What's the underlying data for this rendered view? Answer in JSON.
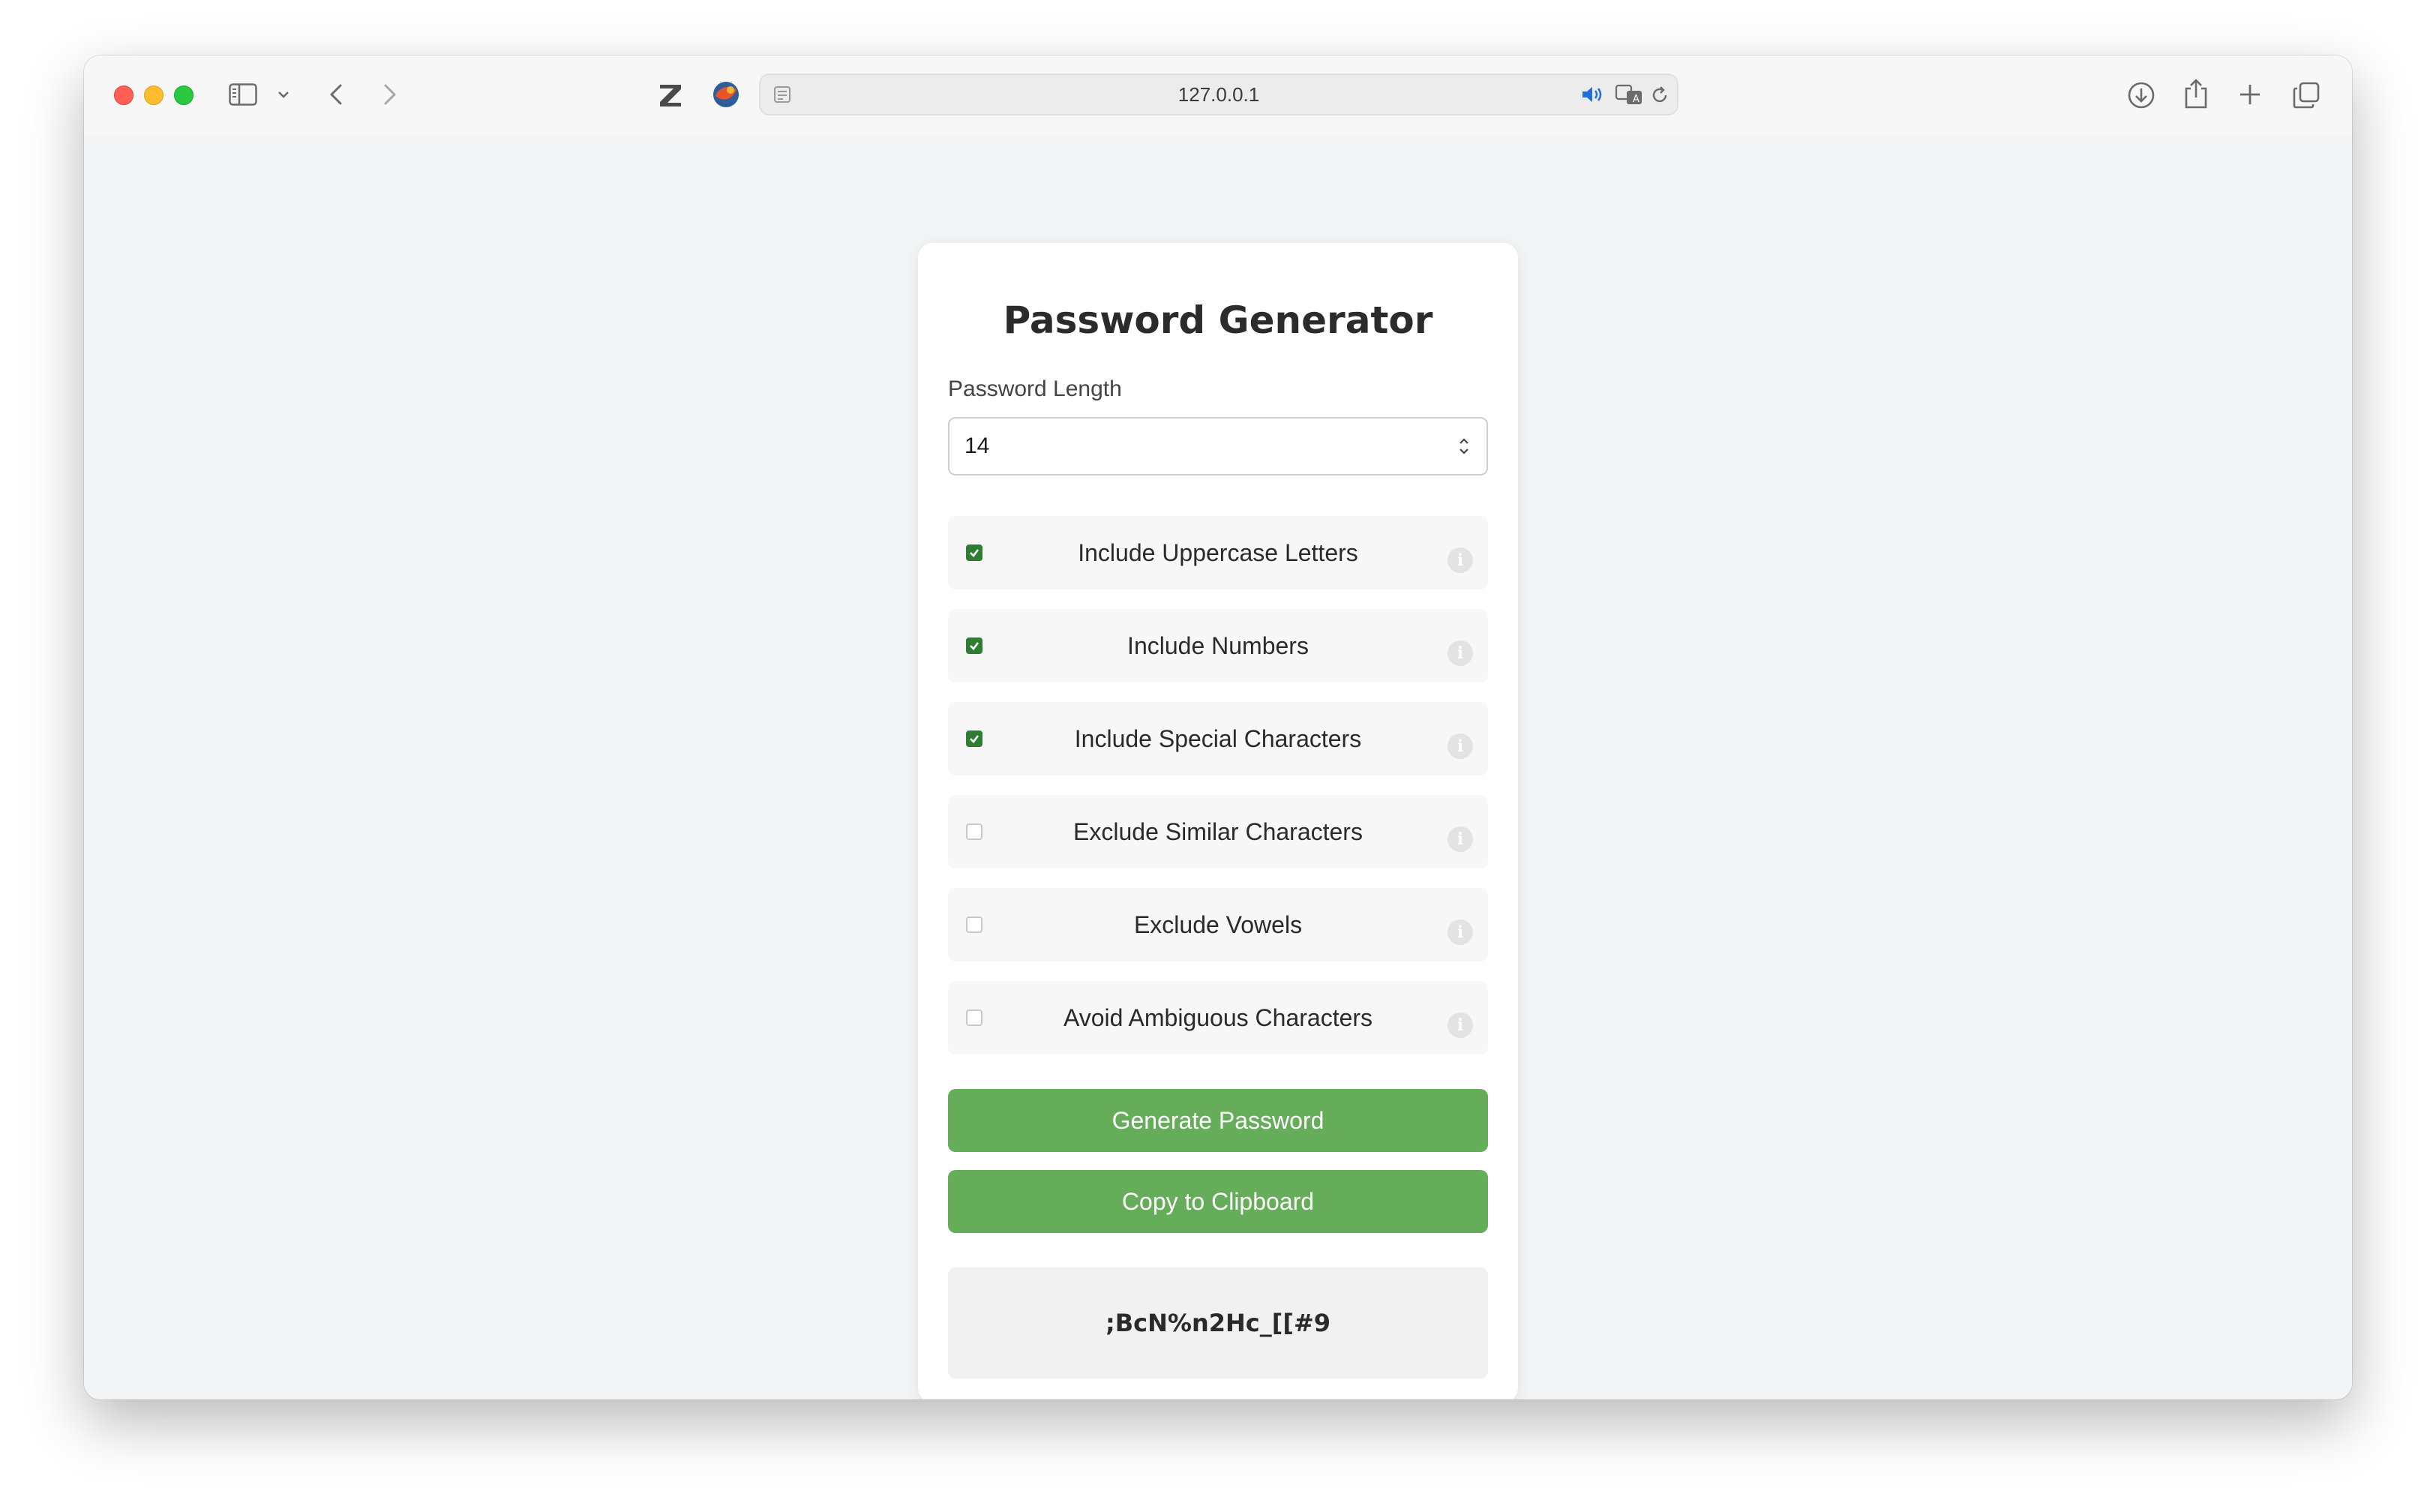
{
  "browser": {
    "url": "127.0.0.1"
  },
  "page": {
    "title": "Password Generator",
    "length_label": "Password Length",
    "length_value": "14",
    "options": [
      {
        "label": "Include Uppercase Letters",
        "checked": true
      },
      {
        "label": "Include Numbers",
        "checked": true
      },
      {
        "label": "Include Special Characters",
        "checked": true
      },
      {
        "label": "Exclude Similar Characters",
        "checked": false
      },
      {
        "label": "Exclude Vowels",
        "checked": false
      },
      {
        "label": "Avoid Ambiguous Characters",
        "checked": false
      }
    ],
    "info_glyph": "i",
    "generate_button": "Generate Password",
    "copy_button": "Copy to Clipboard",
    "generated_password": ";BcN%n2Hc_[[#9"
  },
  "colors": {
    "accent_green": "#66ad5a",
    "checkbox_green": "#2e7d32",
    "page_background": "#f3f4f5"
  },
  "icons": {
    "toolbar_left": [
      "sidebar-icon",
      "chevron-down-icon",
      "back-arrow-icon",
      "forward-arrow-icon"
    ],
    "toolbar_extensions": [
      "zotero-icon",
      "extension-icon"
    ],
    "address_bar": [
      "page-icon",
      "speaker-icon",
      "translate-icon",
      "reload-icon"
    ],
    "toolbar_right": [
      "download-icon",
      "share-icon",
      "new-tab-icon",
      "tab-overview-icon"
    ]
  }
}
